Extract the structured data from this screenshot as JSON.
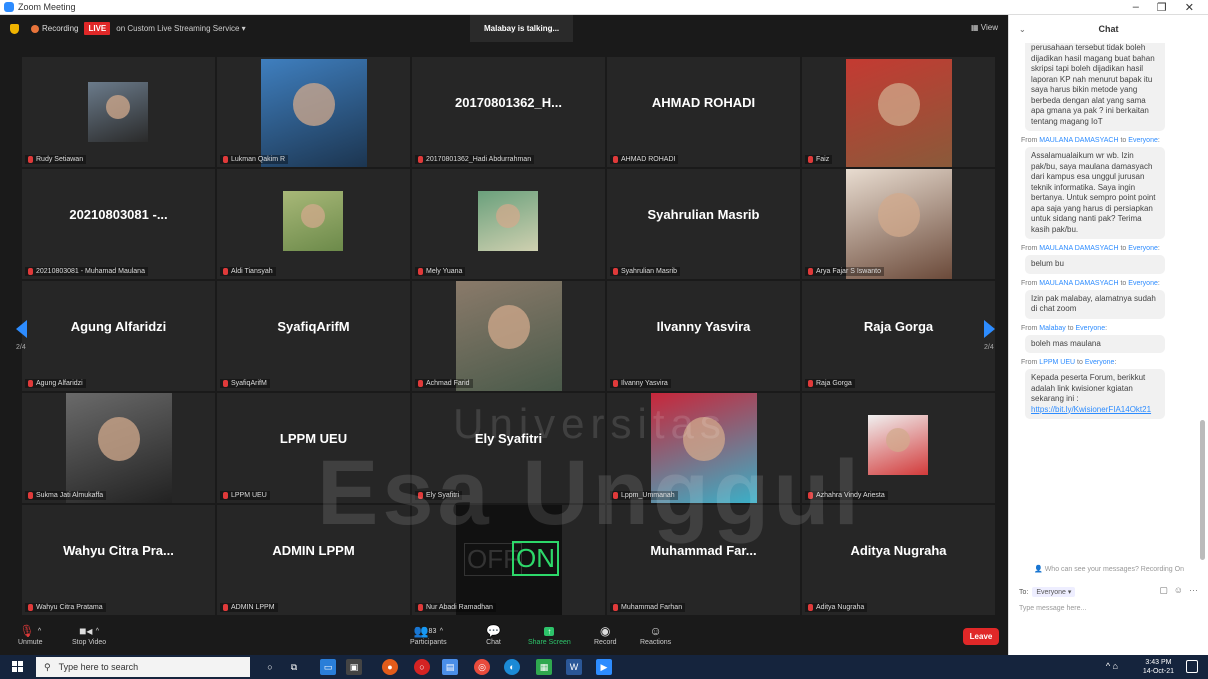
{
  "window": {
    "title": "Zoom Meeting"
  },
  "topbar": {
    "recording": "Recording",
    "live": "LIVE",
    "stream": "on Custom Live Streaming Service",
    "talking": "Malabay is talking...",
    "view": "View"
  },
  "tiles": [
    {
      "big": "",
      "label": "Rudy Setiawan"
    },
    {
      "big": "",
      "label": "Lukman Qakim R"
    },
    {
      "big": "20170801362_H...",
      "label": "20170801362_Hadi Abdurrahman"
    },
    {
      "big": "AHMAD ROHADI",
      "label": "AHMAD ROHADI"
    },
    {
      "big": "",
      "label": "Faiz"
    },
    {
      "big": "20210803081 -...",
      "label": "20210803081 - Muhamad Maulana"
    },
    {
      "big": "",
      "label": "Aldi Tiansyah"
    },
    {
      "big": "",
      "label": "Mely Yuana"
    },
    {
      "big": "Syahrulian Masrib",
      "label": "Syahrulian Masrib"
    },
    {
      "big": "",
      "label": "Arya Fajar S Iswanto"
    },
    {
      "big": "Agung Alfaridzi",
      "label": "Agung Alfaridzi"
    },
    {
      "big": "SyafiqArifM",
      "label": "SyafiqArifM"
    },
    {
      "big": "",
      "label": "Achmad Farid"
    },
    {
      "big": "Ilvanny Yasvira",
      "label": "Ilvanny Yasvira"
    },
    {
      "big": "Raja Gorga",
      "label": "Raja Gorga"
    },
    {
      "big": "",
      "label": "Sukma Jati Almukaffa"
    },
    {
      "big": "LPPM UEU",
      "label": "LPPM UEU"
    },
    {
      "big": "Ely Syafitri",
      "label": "Ely Syafitri"
    },
    {
      "big": "",
      "label": "Lppm_Ummanah"
    },
    {
      "big": "",
      "label": "Azhahra Vindy Ariesta"
    },
    {
      "big": "Wahyu Citra Pra...",
      "label": "Wahyu Citra Pratama"
    },
    {
      "big": "ADMIN LPPM",
      "label": "ADMIN LPPM"
    },
    {
      "big": "",
      "label": "Nur Abadi Ramadhan"
    },
    {
      "big": "Muhammad Far...",
      "label": "Muhammad Farhan"
    },
    {
      "big": "Aditya Nugraha",
      "label": "Aditya Nugraha"
    }
  ],
  "pager": {
    "left": "2/4",
    "right": "2/4"
  },
  "watermark": {
    "line1": "Universitas",
    "line2": "Esa Unggul"
  },
  "toolbar": {
    "unmute": "Unmute",
    "stop_video": "Stop Video",
    "participants": "Participants",
    "participants_count": "83",
    "chat": "Chat",
    "share": "Share Screen",
    "record": "Record",
    "reactions": "Reactions",
    "leave": "Leave"
  },
  "chat": {
    "title": "Chat",
    "messages": [
      {
        "from": "",
        "to": "",
        "text": "perusahaan tersebut tidak boleh dijadikan hasil magang buat bahan skripsi tapi boleh dijadikan hasil laporan KP nah menurut bapak itu saya harus bikin metode yang berbeda dengan alat yang sama apa gmana ya pak ? ini berkaitan tentang magang IoT"
      },
      {
        "from": "MAULANA DAMASYACH",
        "to": "Everyone",
        "text": "Assalamualaikum wr wb. Izin pak/bu, saya maulana damasyach dari kampus esa unggul jurusan teknik informatika. Saya ingin bertanya. Untuk sempro point point apa saja yang harus di persiapkan untuk sidang nanti pak? Terima kasih pak/bu."
      },
      {
        "from": "MAULANA DAMASYACH",
        "to": "Everyone",
        "text": "belum bu"
      },
      {
        "from": "MAULANA DAMASYACH",
        "to": "Everyone",
        "text": "Izin pak malabay, alamatnya sudah di chat zoom"
      },
      {
        "from": "Malabay",
        "to": "Everyone",
        "text": "boleh mas maulana"
      },
      {
        "from": "LPPM UEU",
        "to": "Everyone",
        "text": "Kepada peserta Forum, berikkut adalah link kwisioner kgiatan sekarang ini :",
        "link": "https://bit.ly/KwisionerFIA14Okt21"
      }
    ],
    "from_word": "From",
    "to_word": "to",
    "who_can_see": "Who can see your messages? Recording On",
    "to_label": "To:",
    "to_value": "Everyone",
    "placeholder": "Type message here..."
  },
  "taskbar": {
    "search": "Type here to search",
    "time": "3:43 PM",
    "date": "14-Oct-21"
  }
}
